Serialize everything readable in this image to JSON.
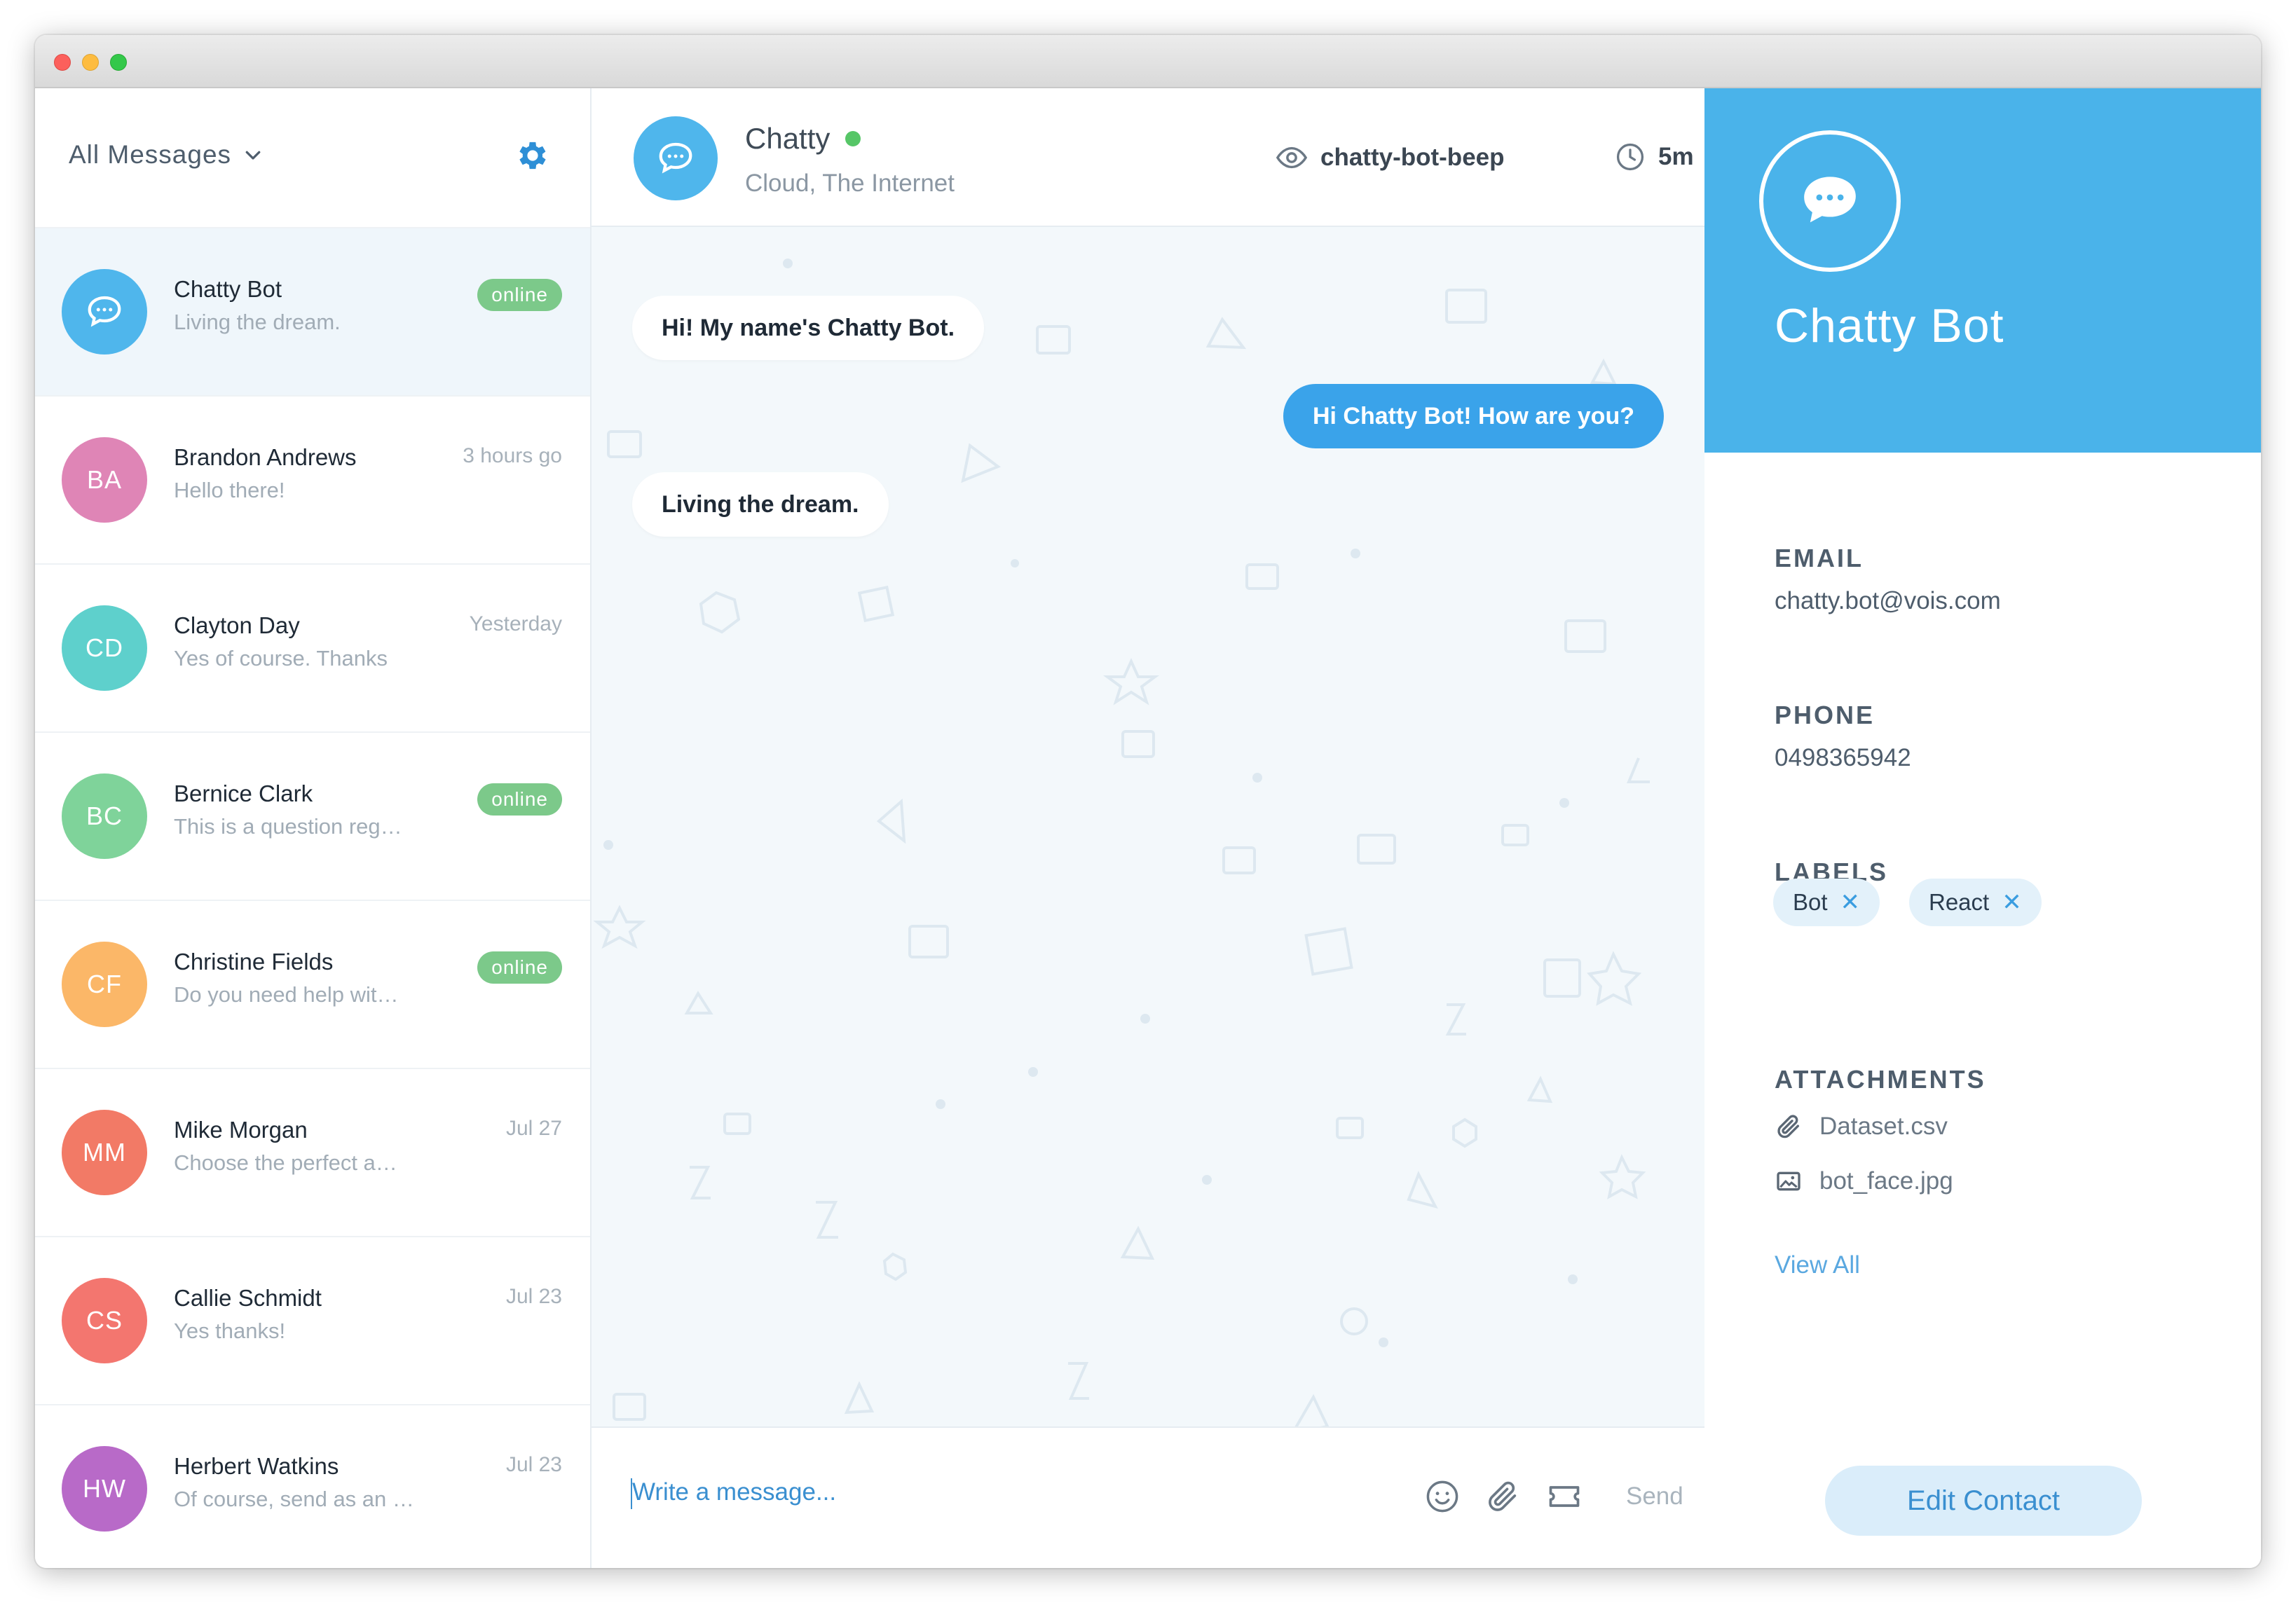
{
  "sidebar": {
    "filter_label": "All Messages",
    "conversations": [
      {
        "initials": "",
        "name": "Chatty Bot",
        "preview": "Living the dream.",
        "status": "online",
        "time": "",
        "color": "#4fb6ec"
      },
      {
        "initials": "BA",
        "name": "Brandon Andrews",
        "preview": "Hello there!",
        "status": "",
        "time": "3 hours go",
        "color": "#df85b6"
      },
      {
        "initials": "CD",
        "name": "Clayton Day",
        "preview": "Yes of course. Thanks",
        "status": "",
        "time": "Yesterday",
        "color": "#5ed0cc"
      },
      {
        "initials": "BC",
        "name": "Bernice Clark",
        "preview": "This is a question reg…",
        "status": "online",
        "time": "",
        "color": "#7fd39a"
      },
      {
        "initials": "CF",
        "name": "Christine Fields",
        "preview": "Do you need help wit…",
        "status": "online",
        "time": "",
        "color": "#fbb768"
      },
      {
        "initials": "MM",
        "name": "Mike Morgan",
        "preview": "Choose the perfect a…",
        "status": "",
        "time": "Jul 27",
        "color": "#f27a66"
      },
      {
        "initials": "CS",
        "name": "Callie Schmidt",
        "preview": "Yes thanks!",
        "status": "",
        "time": "Jul 23",
        "color": "#f3766f"
      },
      {
        "initials": "HW",
        "name": "Herbert Watkins",
        "preview": "Of course, send as an …",
        "status": "",
        "time": "Jul 23",
        "color": "#b86ac8"
      }
    ]
  },
  "chat": {
    "title": "Chatty",
    "subtitle": "Cloud, The Internet",
    "views_label": "chatty-bot-beep",
    "time_label": "5m",
    "messages": [
      {
        "direction": "in",
        "text": "Hi! My name's Chatty Bot."
      },
      {
        "direction": "out",
        "text": "Hi Chatty Bot! How are you?"
      },
      {
        "direction": "in",
        "text": "Living the dream."
      }
    ],
    "composer_placeholder": "Write a message...",
    "send_label": "Send"
  },
  "contact": {
    "name": "Chatty Bot",
    "email_label": "EMAIL",
    "email": "chatty.bot@vois.com",
    "phone_label": "PHONE",
    "phone": "0498365942",
    "labels_label": "LABELS",
    "labels": [
      "Bot",
      "React"
    ],
    "tag_remove_glyph": "✕",
    "attachments_label": "ATTACHMENTS",
    "attachments": [
      {
        "name": "Dataset.csv",
        "icon": "paperclip-icon"
      },
      {
        "name": "bot_face.jpg",
        "icon": "image-icon"
      }
    ],
    "view_all_label": "View All",
    "edit_label": "Edit Contact"
  },
  "colors": {
    "accent": "#4ab3ea",
    "online_badge": "#7cc98a",
    "online_dot": "#56c667",
    "chat_background": "#f3f8fb",
    "outgoing_bubble": "#3aa3ea"
  }
}
